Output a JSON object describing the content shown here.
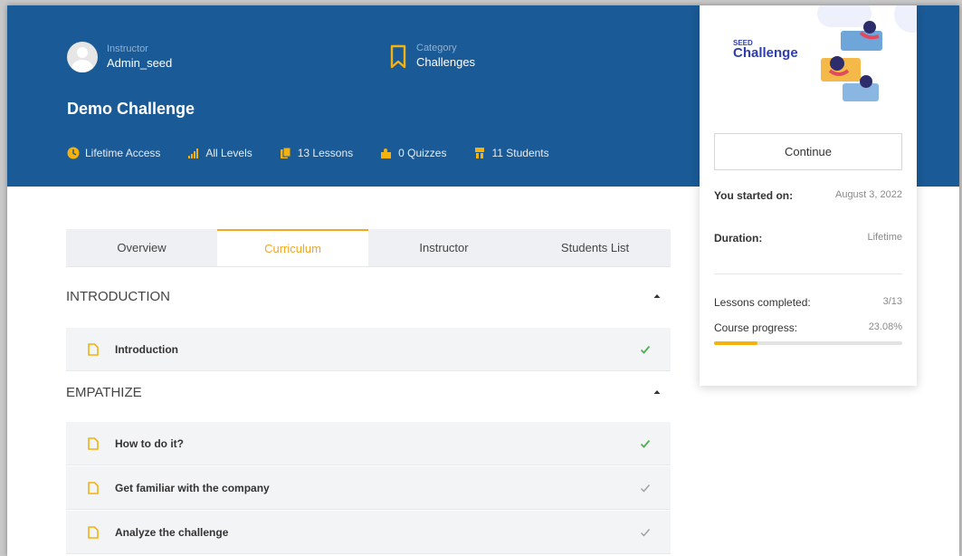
{
  "header": {
    "instructor_label": "Instructor",
    "instructor_name": "Admin_seed",
    "category_label": "Category",
    "category_value": "Challenges",
    "course_title": "Demo Challenge",
    "stats": {
      "access": "Lifetime Access",
      "levels": "All Levels",
      "lessons": "13 Lessons",
      "quizzes": "0 Quizzes",
      "students": "11 Students"
    }
  },
  "sidebar": {
    "promo_small": "SEED",
    "promo_big": "Challenge",
    "continue_label": "Continue",
    "started_label": "You started on:",
    "started_value": "August 3, 2022",
    "duration_label": "Duration:",
    "duration_value": "Lifetime",
    "lessons_completed_label": "Lessons completed:",
    "lessons_completed_value": "3/13",
    "progress_label": "Course progress:",
    "progress_value": "23.08%",
    "progress_fraction": 0.2308
  },
  "tabs": [
    {
      "label": "Overview"
    },
    {
      "label": "Curriculum"
    },
    {
      "label": "Instructor"
    },
    {
      "label": "Students List"
    }
  ],
  "curriculum": {
    "sections": [
      {
        "title": "INTRODUCTION",
        "lessons": [
          {
            "name": "Introduction",
            "status": "completed"
          }
        ]
      },
      {
        "title": "EMPATHIZE",
        "lessons": [
          {
            "name": "How to do it?",
            "status": "completed"
          },
          {
            "name": "Get familiar with the company",
            "status": "pending"
          },
          {
            "name": "Analyze the challenge",
            "status": "pending"
          }
        ]
      }
    ]
  },
  "colors": {
    "header_bg": "#1a5a96",
    "accent": "#f5a623",
    "complete_check": "#4caf50",
    "pending_check": "#9e9e9e"
  }
}
